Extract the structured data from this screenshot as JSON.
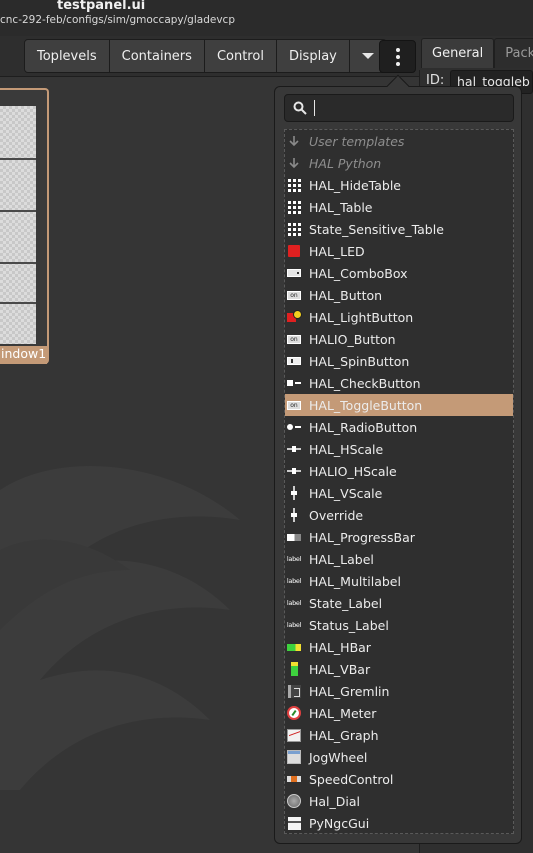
{
  "window": {
    "title": "testpanel.ui",
    "path": "cnc-292-feb/configs/sim/gmoccapy/gladevcp"
  },
  "toolbar": {
    "buttons": [
      "Toplevels",
      "Containers",
      "Control",
      "Display"
    ],
    "more_icon": "chevron-down-icon",
    "menu_icon": "vertical-ellipsis-icon"
  },
  "tabs": [
    "General",
    "Packi"
  ],
  "properties": {
    "id_label": "ID:",
    "id_value": "hal_toggleb"
  },
  "canvas": {
    "window_label": "indow1"
  },
  "popover": {
    "search_value": "",
    "search_icon": "search-icon",
    "selected": "HAL_ToggleButton",
    "items": [
      {
        "label": "User templates",
        "icon": "arrow-down-icon",
        "dim": true
      },
      {
        "label": "HAL Python",
        "icon": "arrow-down-icon",
        "dim": true
      },
      {
        "label": "HAL_HideTable",
        "icon": "table-grid-icon"
      },
      {
        "label": "HAL_Table",
        "icon": "table-grid-icon"
      },
      {
        "label": "State_Sensitive_Table",
        "icon": "table-grid-icon"
      },
      {
        "label": "HAL_LED",
        "icon": "led-icon"
      },
      {
        "label": "HAL_ComboBox",
        "icon": "combobox-icon"
      },
      {
        "label": "HAL_Button",
        "icon": "button-icon"
      },
      {
        "label": "HAL_LightButton",
        "icon": "light-button-icon"
      },
      {
        "label": "HALIO_Button",
        "icon": "button-icon"
      },
      {
        "label": "HAL_SpinButton",
        "icon": "spin-button-icon"
      },
      {
        "label": "HAL_CheckButton",
        "icon": "check-button-icon"
      },
      {
        "label": "HAL_ToggleButton",
        "icon": "button-icon"
      },
      {
        "label": "HAL_RadioButton",
        "icon": "radio-button-icon"
      },
      {
        "label": "HAL_HScale",
        "icon": "hscale-icon"
      },
      {
        "label": "HALIO_HScale",
        "icon": "hscale-icon"
      },
      {
        "label": "HAL_VScale",
        "icon": "vscale-icon"
      },
      {
        "label": "Override",
        "icon": "vscale-icon"
      },
      {
        "label": "HAL_ProgressBar",
        "icon": "progress-bar-icon"
      },
      {
        "label": "HAL_Label",
        "icon": "label-icon"
      },
      {
        "label": "HAL_Multilabel",
        "icon": "label-icon"
      },
      {
        "label": "State_Label",
        "icon": "label-icon"
      },
      {
        "label": "Status_Label",
        "icon": "label-icon"
      },
      {
        "label": "HAL_HBar",
        "icon": "hbar-icon"
      },
      {
        "label": "HAL_VBar",
        "icon": "vbar-icon"
      },
      {
        "label": "HAL_Gremlin",
        "icon": "gremlin-icon"
      },
      {
        "label": "HAL_Meter",
        "icon": "meter-icon"
      },
      {
        "label": "HAL_Graph",
        "icon": "graph-icon"
      },
      {
        "label": "JogWheel",
        "icon": "jogwheel-icon"
      },
      {
        "label": "SpeedControl",
        "icon": "speed-control-icon"
      },
      {
        "label": "Hal_Dial",
        "icon": "dial-icon"
      },
      {
        "label": "PyNgcGui",
        "icon": "pyngcgui-icon"
      }
    ]
  },
  "icon_text": {
    "button": "on",
    "label": "label"
  },
  "colors": {
    "accent": "#c49a77",
    "background": "#353535"
  }
}
